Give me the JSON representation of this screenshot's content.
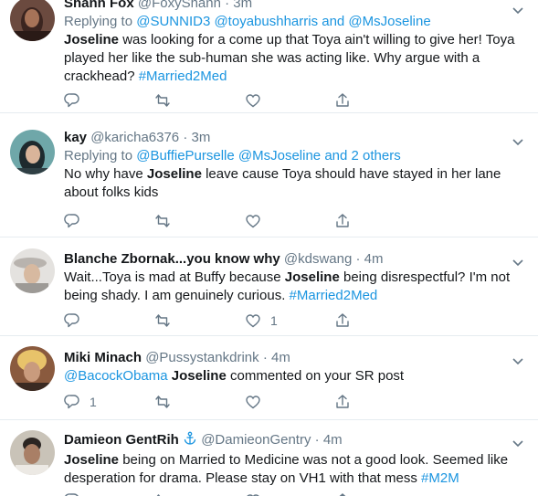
{
  "colors": {
    "link": "#1b95e0",
    "muted": "#657786",
    "text": "#14171a",
    "divider": "#e6ecf0"
  },
  "icons": {
    "reply": "reply-icon",
    "retweet": "retweet-icon",
    "like": "heart-icon",
    "share": "share-icon",
    "menu": "chevron-down-icon",
    "badge": "anchor-icon"
  },
  "tweets": [
    {
      "name": "Shann Fox",
      "handle": "@FoxyShann",
      "time": "3m",
      "reply_prefix": "Replying to",
      "reply_to": "@SUNNID3 @toyabushharris and @MsJoseline",
      "text_bold": "Joseline",
      "text_rest": " was looking for a come up that Toya ain't willing to give her! Toya played her like the sub-human she was acting like. Why argue with a crackhead? ",
      "hashtag": "#Married2Med"
    },
    {
      "name": "kay",
      "handle": "@karicha6376",
      "time": "3m",
      "reply_prefix": "Replying to",
      "reply_to": "@BuffiePurselle @MsJoseline and 2 others",
      "text_pre": "No why have ",
      "text_bold": "Joseline",
      "text_rest": " leave cause Toya should have stayed in her lane about folks kids"
    },
    {
      "name": "Blanche Zbornak...you know why",
      "handle": "@kdswang",
      "time": "4m",
      "text_pre": "Wait...Toya is mad at Buffy because ",
      "text_bold": "Joseline",
      "text_rest": " being disrespectful? I'm not being shady. I am genuinely curious. ",
      "hashtag": "#Married2Med",
      "likes": "1"
    },
    {
      "name": "Miki Minach",
      "handle": "@Pussystankdrink",
      "time": "4m",
      "mention": "@BacockObama",
      "text_bold": "Joseline",
      "text_rest": " commented on your SR post",
      "replies": "1"
    },
    {
      "name": "Damieon GentRih",
      "handle": "@DamieonGentry",
      "time": "4m",
      "text_bold": "Joseline",
      "text_rest": " being on Married to Medicine was not a good look. Seemed like desperation for drama. Please stay on VH1 with that mess ",
      "hashtag": "#M2M"
    }
  ]
}
